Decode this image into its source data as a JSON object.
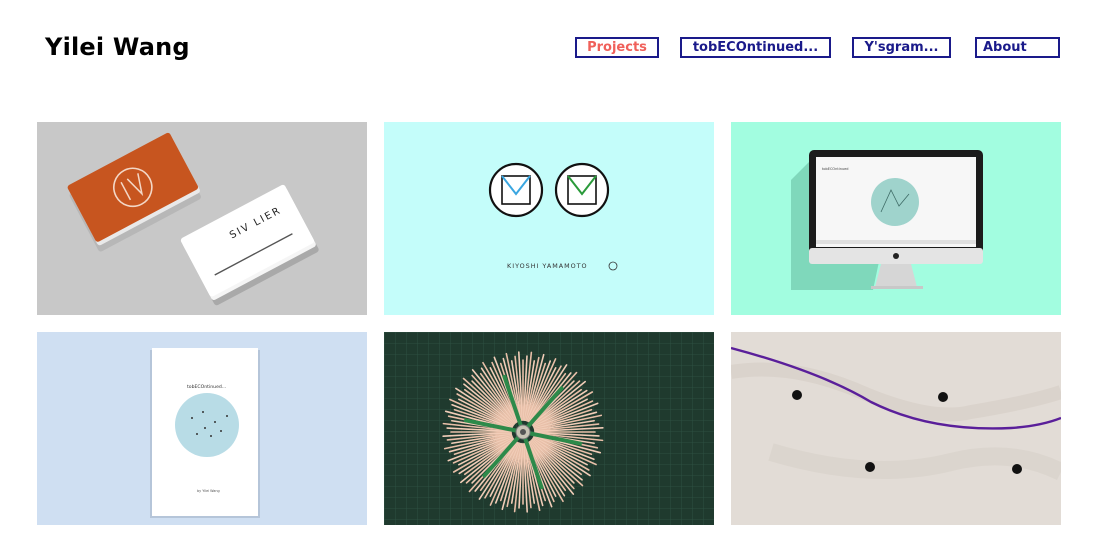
{
  "site": {
    "title": "Yilei Wang"
  },
  "nav": [
    {
      "label": "Projects",
      "active": true
    },
    {
      "label": "tobECOntinued...",
      "active": false
    },
    {
      "label": "Y'sgram...",
      "active": false
    },
    {
      "label": "About",
      "active": false
    }
  ],
  "projects": [
    {
      "name": "SIV LIER business cards",
      "card_text": "SIV LIER",
      "bg": "#c8c8c8",
      "accent": "#c7551f"
    },
    {
      "name": "Kiyoshi Yamamoto logo",
      "caption": "KIYOSHI YAMAMOTO",
      "bg": "#c4fdfa"
    },
    {
      "name": "tobECOntinued website on iMac",
      "screen_title": "tobECOntinued",
      "bg": "#a2fde0"
    },
    {
      "name": "tobECOntinued book",
      "book_title": "tobECOntinued...",
      "book_author": "by Yilei Wang",
      "bg": "#cfdff2"
    },
    {
      "name": "Wooden stick sculpture",
      "bg": "#1f3a2e"
    },
    {
      "name": "Plywood and purple cord",
      "bg": "#e2dcd6",
      "accent": "#5a1f9a"
    }
  ],
  "colors": {
    "nav_border": "#1a1a8a",
    "nav_active": "#f0605a"
  }
}
